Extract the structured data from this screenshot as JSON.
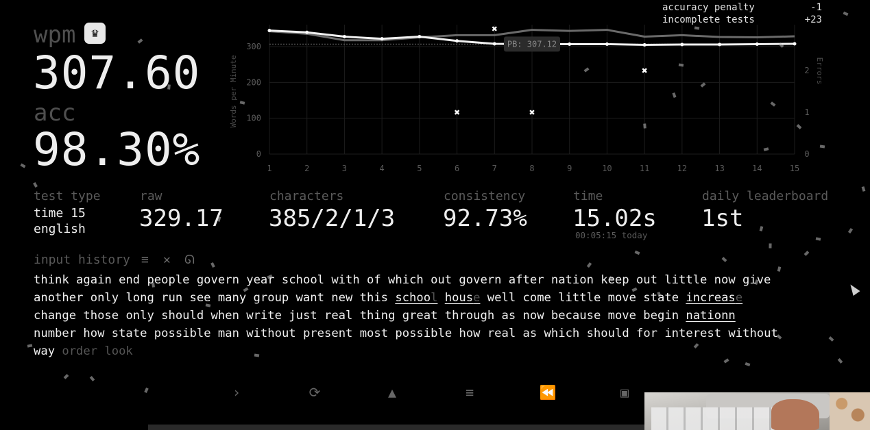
{
  "header": {
    "wpm_label": "wpm",
    "wpm_value": "307.60",
    "acc_label": "acc",
    "acc_value": "98.30%",
    "crown_icon": "crown-icon"
  },
  "penalties": [
    {
      "label": "accuracy penalty",
      "value": "-1"
    },
    {
      "label": "incomplete tests",
      "value": "+23"
    }
  ],
  "chart_data": {
    "type": "line",
    "x": [
      1,
      2,
      3,
      4,
      5,
      6,
      7,
      8,
      9,
      10,
      11,
      12,
      13,
      14,
      15
    ],
    "series": [
      {
        "values": [
          345,
          340,
          328,
          322,
          328,
          316,
          308,
          307,
          307,
          307,
          305,
          306,
          306,
          307,
          308
        ],
        "color": "#f0f0f0"
      },
      {
        "values": [
          343,
          336,
          318,
          318,
          326,
          332,
          332,
          347,
          344,
          347,
          328,
          332,
          327,
          326,
          329
        ],
        "color": "#6a6a6a"
      }
    ],
    "errors": [
      {
        "x": 6,
        "y": 1
      },
      {
        "x": 7,
        "y": 3
      },
      {
        "x": 8,
        "y": 1
      },
      {
        "x": 11,
        "y": 2
      }
    ],
    "ylabel": "Words per Minute",
    "y2label": "Errors",
    "ylim": [
      0,
      350
    ],
    "y2lim": [
      0,
      3
    ],
    "yticks": [
      0,
      100,
      200,
      300
    ],
    "y2ticks": [
      0,
      1,
      2
    ],
    "pb_value": 307.12,
    "pb_label": "PB: 307.12",
    "grid": true
  },
  "stats": {
    "test_type_label": "test type",
    "test_type_line1": "time 15",
    "test_type_line2": "english",
    "raw_label": "raw",
    "raw_value": "329.17",
    "characters_label": "characters",
    "characters_value": "385/2/1/3",
    "consistency_label": "consistency",
    "consistency_value": "92.73%",
    "time_label": "time",
    "time_value": "15.02s",
    "time_sub": "00:05:15 today",
    "leaderboard_label": "daily leaderboard",
    "leaderboard_value": "1st"
  },
  "input_history": {
    "label": "input history",
    "lines": [
      [
        {
          "t": "think"
        },
        {
          "t": "again"
        },
        {
          "t": "end"
        },
        {
          "t": "people"
        },
        {
          "t": "govern"
        },
        {
          "t": "year"
        },
        {
          "t": "school"
        },
        {
          "t": "with"
        },
        {
          "t": "of"
        },
        {
          "t": "which"
        },
        {
          "t": "out"
        },
        {
          "t": "govern"
        },
        {
          "t": "after"
        },
        {
          "t": "nation"
        },
        {
          "t": "keep"
        },
        {
          "t": "out"
        },
        {
          "t": "little"
        },
        {
          "t": "now"
        },
        {
          "t": "give"
        }
      ],
      [
        {
          "t": "another"
        },
        {
          "t": "only"
        },
        {
          "t": "long"
        },
        {
          "t": "run"
        },
        {
          "t": "see"
        },
        {
          "t": "many"
        },
        {
          "t": "group"
        },
        {
          "t": "want"
        },
        {
          "t": "new"
        },
        {
          "t": "this"
        },
        {
          "t": "schoo",
          "miss": "l",
          "err": true
        },
        {
          "t": "hous",
          "miss": "e",
          "err": true
        },
        {
          "t": "well"
        },
        {
          "t": "come"
        },
        {
          "t": "little"
        },
        {
          "t": "move"
        },
        {
          "t": "state"
        },
        {
          "t": "increas",
          "miss": "e",
          "err": true
        }
      ],
      [
        {
          "t": "change"
        },
        {
          "t": "those"
        },
        {
          "t": "only"
        },
        {
          "t": "should"
        },
        {
          "t": "when"
        },
        {
          "t": "write"
        },
        {
          "t": "just"
        },
        {
          "t": "real"
        },
        {
          "t": "thing"
        },
        {
          "t": "great"
        },
        {
          "t": "through"
        },
        {
          "t": "as"
        },
        {
          "t": "now"
        },
        {
          "t": "because"
        },
        {
          "t": "move"
        },
        {
          "t": "begin"
        },
        {
          "t": "nationn",
          "err": true
        }
      ],
      [
        {
          "t": "number"
        },
        {
          "t": "how"
        },
        {
          "t": "state"
        },
        {
          "t": "possible"
        },
        {
          "t": "man"
        },
        {
          "t": "without"
        },
        {
          "t": "present"
        },
        {
          "t": "most"
        },
        {
          "t": "possible"
        },
        {
          "t": "how"
        },
        {
          "t": "real"
        },
        {
          "t": "as"
        },
        {
          "t": "which"
        },
        {
          "t": "should"
        },
        {
          "t": "for"
        },
        {
          "t": "interest"
        },
        {
          "t": "without"
        }
      ],
      [
        {
          "t": "way"
        },
        {
          "t": "order",
          "untyped": true
        },
        {
          "t": "look",
          "untyped": true
        }
      ]
    ]
  },
  "buttons": [
    {
      "name": "next-test-button",
      "icon": "chevron-right-icon",
      "glyph": "›"
    },
    {
      "name": "restart-test-button",
      "icon": "refresh-icon",
      "glyph": "⟳"
    },
    {
      "name": "report-button",
      "icon": "warning-icon",
      "glyph": "▲"
    },
    {
      "name": "words-history-button",
      "icon": "align-left-icon",
      "glyph": "≡"
    },
    {
      "name": "replay-button",
      "icon": "rewind-icon",
      "glyph": "⏪"
    },
    {
      "name": "screenshot-button",
      "icon": "image-icon",
      "glyph": "▣"
    }
  ]
}
